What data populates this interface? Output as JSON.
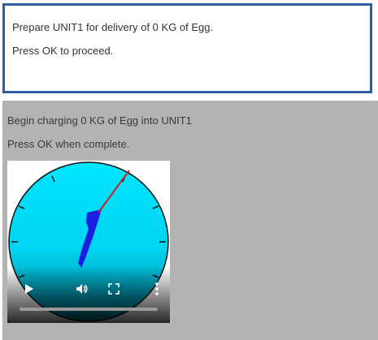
{
  "previous_step": {
    "line1": "Prepare UNIT1 for delivery of 0 KG of Egg.",
    "line2": "Press OK to proceed."
  },
  "current_step": {
    "line1": "Begin charging 0 KG of Egg into UNIT1",
    "line2": "Press OK when complete."
  },
  "video": {
    "gauge_face_color": "#00e5ff",
    "gauge_digit": "1",
    "needle_color": "#cc1f1f",
    "controls": {
      "play_icon": "play-icon",
      "volume_icon": "volume-icon",
      "fullscreen_icon": "fullscreen-icon",
      "more_icon": "more-vertical-icon"
    },
    "progress_fraction": 0.0
  },
  "colors": {
    "box_border": "#2e5da8",
    "panel_background": "#b3b3b3"
  }
}
